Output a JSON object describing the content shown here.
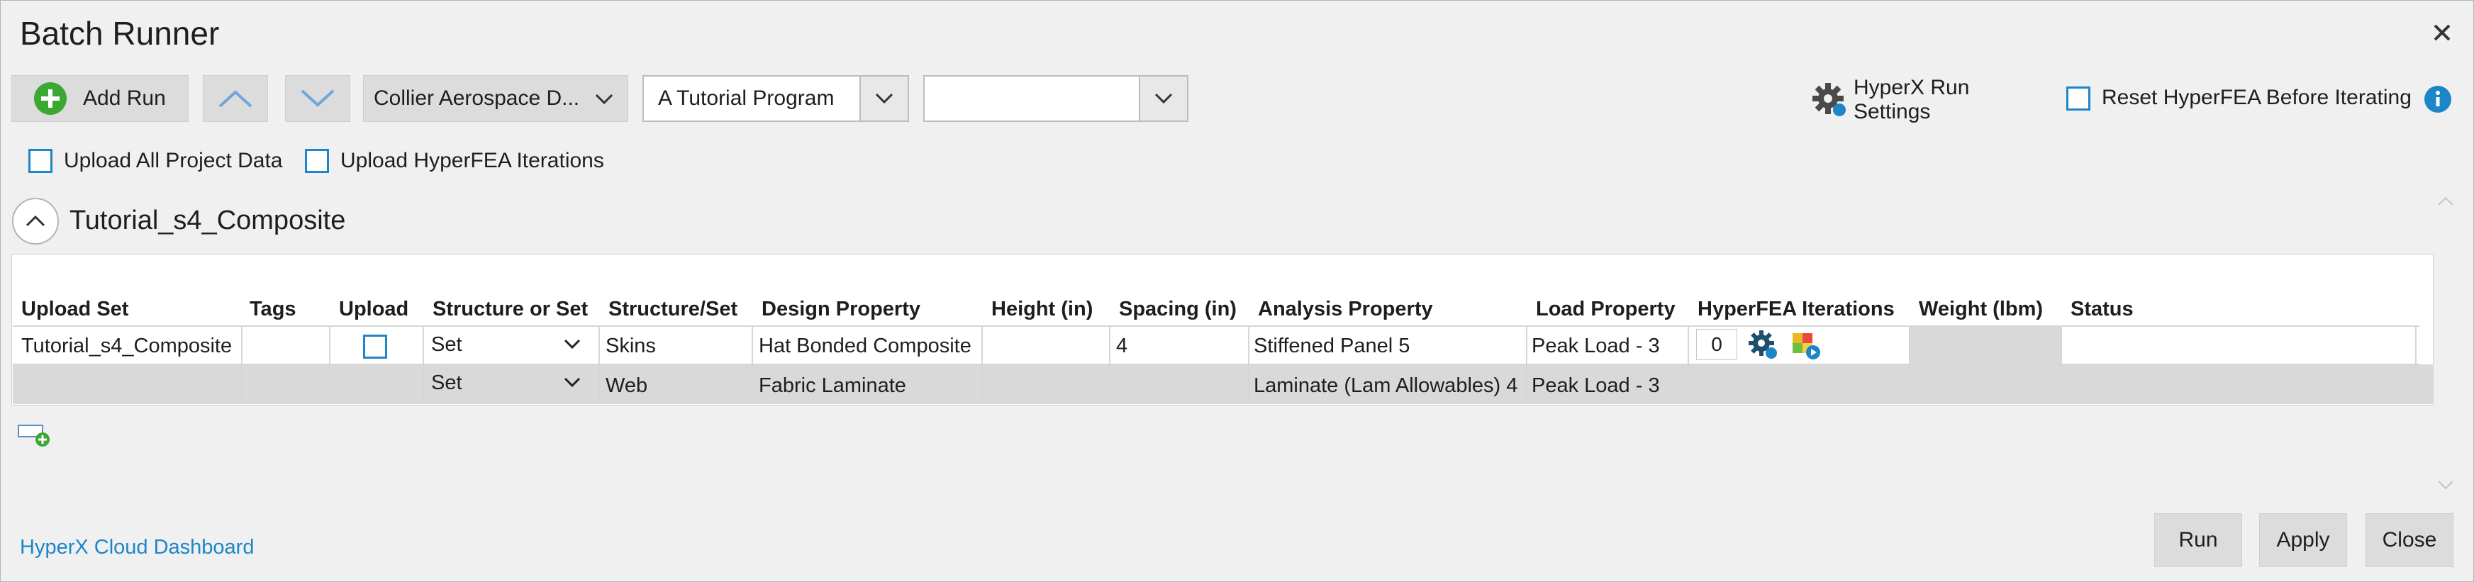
{
  "window": {
    "title": "Batch Runner"
  },
  "toolbar": {
    "add_run_label": "Add Run",
    "combo1_value": "Collier Aerospace D...",
    "combo2_value": "A Tutorial Program",
    "combo3_value": "",
    "run_settings_label": "HyperX Run Settings",
    "reset_label": "Reset HyperFEA Before Iterating"
  },
  "options": {
    "upload_all_label": "Upload All Project Data",
    "upload_iterations_label": "Upload HyperFEA Iterations"
  },
  "group": {
    "title": "Tutorial_s4_Composite"
  },
  "table": {
    "headers": [
      "Upload Set",
      "Tags",
      "Upload",
      "Structure or Set",
      "Structure/Set",
      "Design Property",
      "Height (in)",
      "Spacing (in)",
      "Analysis Property",
      "Load Property",
      "HyperFEA Iterations",
      "Weight (lbm)",
      "Status"
    ],
    "rows": [
      {
        "upload_set": "Tutorial_s4_Composite",
        "tags": "",
        "structure_or_set": "Set",
        "structure_set": "Skins",
        "design_property": "Hat Bonded Composite",
        "height": "",
        "spacing": "4",
        "analysis_property": "Stiffened Panel 5",
        "load_property": "Peak Load - 3",
        "iterations": "0",
        "weight": "",
        "status": ""
      },
      {
        "upload_set": "",
        "tags": "",
        "structure_or_set": "Set",
        "structure_set": "Web",
        "design_property": "Fabric Laminate",
        "height": "",
        "spacing": "",
        "analysis_property": "Laminate (Lam Allowables) 4",
        "load_property": "Peak Load - 3",
        "iterations": "",
        "weight": "",
        "status": ""
      }
    ]
  },
  "footer": {
    "dashboard_link": "HyperX Cloud Dashboard",
    "run_label": "Run",
    "apply_label": "Apply",
    "close_label": "Close"
  },
  "colors": {
    "accent": "#1c86c8",
    "add_green": "#3aa832",
    "row_gray": "#d9d9d9"
  }
}
